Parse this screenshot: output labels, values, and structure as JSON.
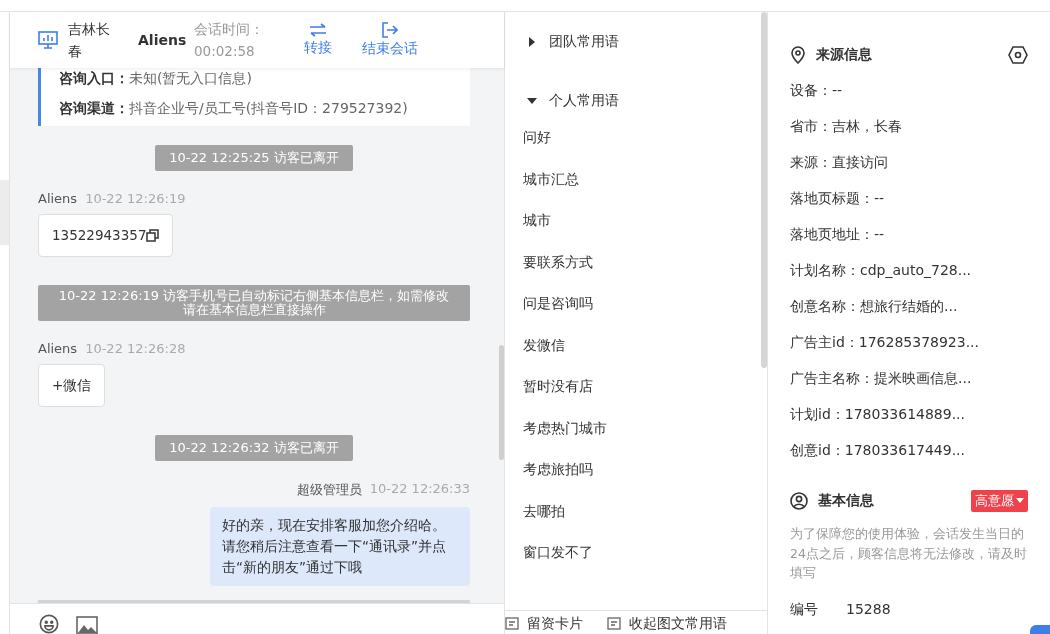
{
  "header": {
    "location": "吉林长春",
    "visitor": "Aliens",
    "time_label": "会话时间：",
    "time": "00:02:58",
    "actions": [
      {
        "kind": "transfer",
        "label": "转接"
      },
      {
        "kind": "end",
        "label": "结束会话"
      }
    ]
  },
  "info_card": [
    {
      "label": "咨询入口：",
      "value": "未知(暂无入口信息)"
    },
    {
      "label": "咨询渠道：",
      "value": "抖音企业号/员工号(抖音号ID：279527392)"
    }
  ],
  "messages": [
    {
      "kind": "system",
      "text": "10-22 12:25:25 访客已离开"
    },
    {
      "kind": "visitor",
      "sender": "Aliens",
      "time": "10-22 12:26:19",
      "text": "13522943357",
      "copyable": true
    },
    {
      "kind": "system",
      "text": "10-22 12:26:19 访客手机号已自动标记右侧基本信息栏，如需修改请在基本信息栏直接操作"
    },
    {
      "kind": "visitor",
      "sender": "Aliens",
      "time": "10-22 12:26:28",
      "text": "+微信"
    },
    {
      "kind": "system",
      "text": "10-22 12:26:32 访客已离开"
    },
    {
      "kind": "agent",
      "sender": "超级管理员",
      "time": "10-22 12:26:33",
      "text": "好的亲，现在安排客服加您介绍哈。请您稍后注意查看一下“通讯录”并点击“新的朋友”通过下哦"
    }
  ],
  "phrases": {
    "groups": [
      {
        "name": "团队常用语",
        "expanded": false
      },
      {
        "name": "个人常用语",
        "expanded": true,
        "children": [
          "问好",
          "城市汇总",
          "城市",
          "要联系方式",
          "问是咨询吗",
          "发微信",
          "暂时没有店",
          "考虑热门城市",
          "考虑旅拍吗",
          "去哪拍",
          "窗口发不了"
        ]
      }
    ],
    "footer": [
      "留资卡片",
      "收起图文常用语"
    ]
  },
  "source_info": {
    "title": "来源信息",
    "fields": [
      "设备：--",
      "省市：吉林，长春",
      "来源：直接访问",
      "落地页标题：--",
      "落地页地址：--",
      "计划名称：cdp_auto_728...",
      "创意名称：想旅行结婚的...",
      "广告主id：176285378923...",
      "广告主名称：提米映画信息...",
      "计划id：178033614889...",
      "创意id：178033617449..."
    ]
  },
  "basic_info": {
    "title": "基本信息",
    "tag": "高意愿",
    "notice": "为了保障您的使用体验，会话发生当日的24点之后，顾客信息将无法修改，请及时填写",
    "fields": [
      {
        "label": "编号",
        "value": "15288"
      }
    ]
  }
}
